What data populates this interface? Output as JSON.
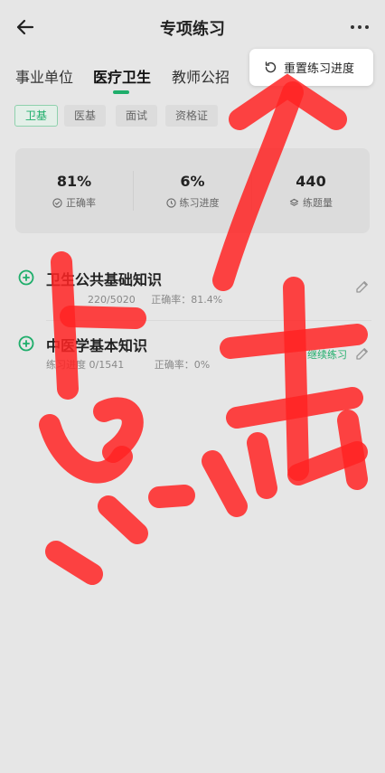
{
  "header": {
    "title": "专项练习"
  },
  "tabs": [
    {
      "label": "事业单位",
      "active": false
    },
    {
      "label": "医疗卫生",
      "active": true
    },
    {
      "label": "教师公招",
      "active": false
    }
  ],
  "popup": {
    "reset_label": "重置练习进度"
  },
  "chips": [
    "卫基",
    "医基",
    "面试",
    "资格证"
  ],
  "stats": [
    {
      "value": "81%",
      "label": "正确率"
    },
    {
      "value": "6%",
      "label": "练习进度"
    },
    {
      "value": "440",
      "label": "练题量"
    }
  ],
  "items": [
    {
      "name": "卫生公共基础知识",
      "progress": "220/5020",
      "accuracy_label": "正确率",
      "accuracy": "81.4%",
      "action": ""
    },
    {
      "name": "中医学基本知识",
      "progress": "练习进度 0/1541",
      "accuracy_label": "正确率",
      "accuracy": "0%",
      "action": "继续练习"
    }
  ],
  "colors": {
    "accent": "#1fae6b",
    "annotation": "#ff2020",
    "background": "#e6e6e6"
  }
}
